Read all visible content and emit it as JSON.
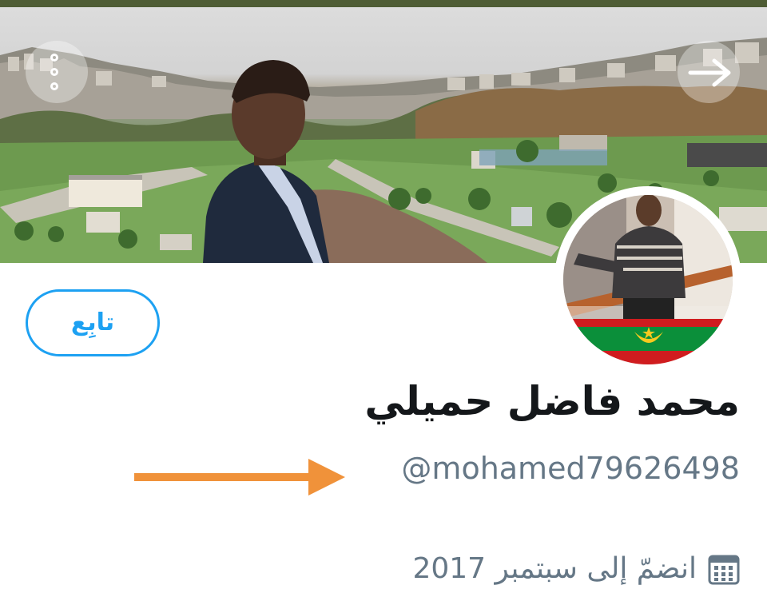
{
  "header": {
    "menu_icon": "more-vertical-icon",
    "next_icon": "arrow-right-icon"
  },
  "profile": {
    "follow_label": "تابِع",
    "display_name": "محمد فاضل حميلي",
    "handle": "@mohamed79626498",
    "joined_label": "انضمّ إلى سبتمبر 2017",
    "joined_icon": "calendar-icon"
  },
  "colors": {
    "accent": "#1da1f2",
    "secondary_text": "#657786",
    "primary_text": "#14171a",
    "annotation_arrow": "#f0923a",
    "top_bar": "#4e5c34"
  }
}
